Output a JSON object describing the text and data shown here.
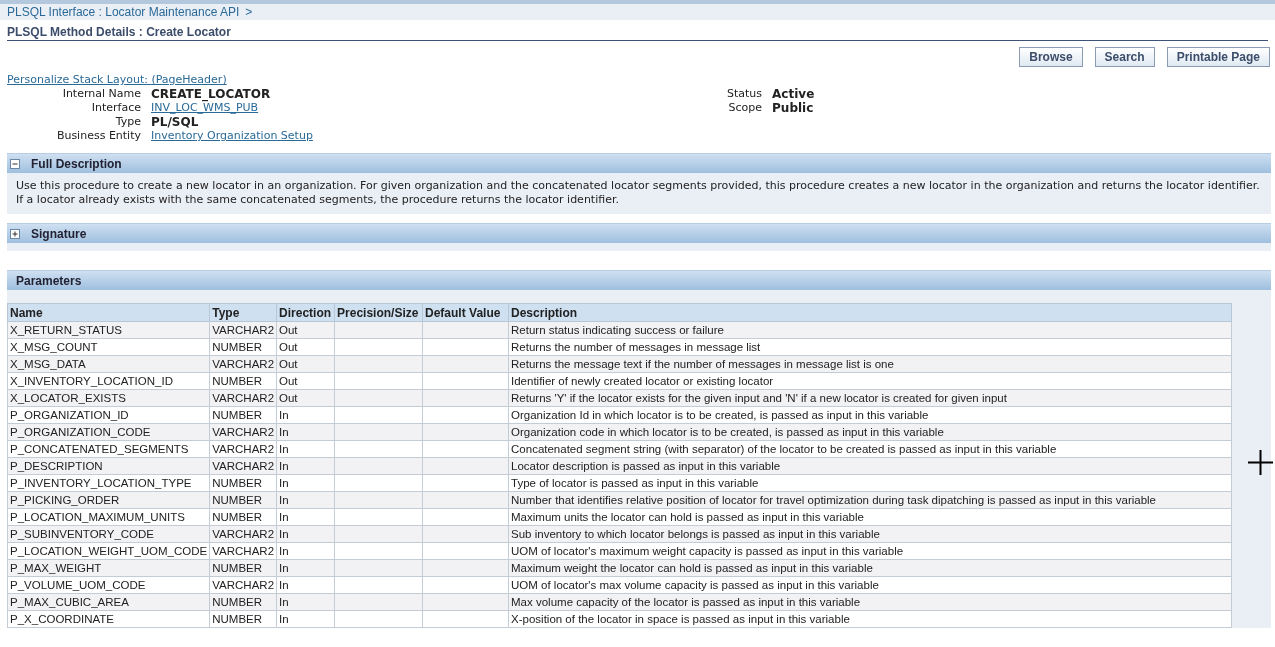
{
  "breadcrumb": {
    "link": "PLSQL Interface : Locator Maintenance API",
    "separator": ">"
  },
  "page_title": "PLSQL Method Details : Create Locator",
  "buttons": [
    "Browse",
    "Search",
    "Printable Page"
  ],
  "personalize_link": "Personalize Stack Layout: (PageHeader)",
  "details_left": [
    {
      "label": "Internal Name",
      "value": "CREATE_LOCATOR",
      "kind": "bold"
    },
    {
      "label": "Interface",
      "value": "INV_LOC_WMS_PUB",
      "kind": "link"
    },
    {
      "label": "Type",
      "value": "PL/SQL",
      "kind": "bold"
    },
    {
      "label": "Business Entity",
      "value": "Inventory Organization Setup",
      "kind": "link"
    }
  ],
  "details_right": [
    {
      "label": "Status",
      "value": "Active",
      "kind": "bold"
    },
    {
      "label": "Scope",
      "value": "Public",
      "kind": "bold"
    }
  ],
  "sections": [
    {
      "title": "Full Description",
      "expanded": true,
      "text": "Use this procedure to create a new locator in an organization. For given organization and the concatenated locator segments provided, this procedure creates a new locator in the organization and returns the locator identifier. If a locator already exists with the same concatenated segments, the procedure returns the locator identifier."
    },
    {
      "title": "Signature",
      "expanded": false
    }
  ],
  "parameters": {
    "title": "Parameters",
    "columns": [
      "Name",
      "Type",
      "Direction",
      "Precision/Size",
      "Default Value",
      "Description"
    ],
    "rows": [
      [
        "X_RETURN_STATUS",
        "VARCHAR2",
        "Out",
        "Return status indicating success or failure"
      ],
      [
        "X_MSG_COUNT",
        "NUMBER",
        "Out",
        "Returns the number of messages in message list"
      ],
      [
        "X_MSG_DATA",
        "VARCHAR2",
        "Out",
        "Returns the message text if the number of messages in message list is one"
      ],
      [
        "X_INVENTORY_LOCATION_ID",
        "NUMBER",
        "Out",
        "Identifier of newly created locator or existing locator"
      ],
      [
        "X_LOCATOR_EXISTS",
        "VARCHAR2",
        "Out",
        "Returns 'Y' if the locator exists for the given input and 'N' if a new locator is created for given input"
      ],
      [
        "P_ORGANIZATION_ID",
        "NUMBER",
        "In",
        "Organization Id in which locator is to be created, is passed as input in this variable"
      ],
      [
        "P_ORGANIZATION_CODE",
        "VARCHAR2",
        "In",
        "Organization code in which locator is to be created, is passed as input in this variable"
      ],
      [
        "P_CONCATENATED_SEGMENTS",
        "VARCHAR2",
        "In",
        "Concatenated segment string (with separator) of the locator to be created is passed as input in this variable"
      ],
      [
        "P_DESCRIPTION",
        "VARCHAR2",
        "In",
        "Locator description is passed as input in this variable"
      ],
      [
        "P_INVENTORY_LOCATION_TYPE",
        "NUMBER",
        "In",
        "Type of locator is passed as input in this variable"
      ],
      [
        "P_PICKING_ORDER",
        "NUMBER",
        "In",
        "Number that identifies relative position of locator for travel optimization during task dipatching is passed as input in this variable"
      ],
      [
        "P_LOCATION_MAXIMUM_UNITS",
        "NUMBER",
        "In",
        "Maximum units the locator can hold is passed as input in this variable"
      ],
      [
        "P_SUBINVENTORY_CODE",
        "VARCHAR2",
        "In",
        "Sub inventory to which locator belongs is passed as input in this variable"
      ],
      [
        "P_LOCATION_WEIGHT_UOM_CODE",
        "VARCHAR2",
        "In",
        "UOM of locator's maximum weight capacity is passed as input in this variable"
      ],
      [
        "P_MAX_WEIGHT",
        "NUMBER",
        "In",
        "Maximum weight the locator can hold is passed as input in this variable"
      ],
      [
        "P_VOLUME_UOM_CODE",
        "VARCHAR2",
        "In",
        "UOM of locator's max volume capacity is passed as input in this variable"
      ],
      [
        "P_MAX_CUBIC_AREA",
        "NUMBER",
        "In",
        "Max volume capacity of the locator is passed as input in this variable"
      ],
      [
        "P_X_COORDINATE",
        "NUMBER",
        "In",
        "X-position of the locator in space is passed as input in this variable"
      ]
    ]
  }
}
